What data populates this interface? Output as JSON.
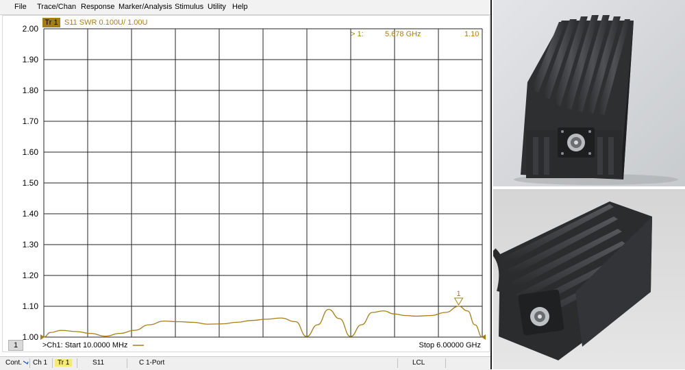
{
  "menu": [
    "File",
    "Trace/Chan",
    "Response",
    "Marker/Analysis",
    "Stimulus",
    "Utility",
    "Help"
  ],
  "trace": {
    "badge": "Tr 1",
    "description": "S11 SWR 0.100U/  1.00U",
    "color": "#a57d18"
  },
  "marker": {
    "label": "> 1:",
    "frequency": "5.678 GHz",
    "value": "1.10",
    "number": "1"
  },
  "channel": {
    "number": "1",
    "start": ">Ch1:  Start  10.0000 MHz",
    "stop": "Stop  6.00000 GHz"
  },
  "status_bar": {
    "mode": "Cont.",
    "channel": "Ch 1",
    "trace": "Tr 1",
    "param": "S11",
    "cal": "C  1-Port",
    "remote": "LCL"
  },
  "chart_data": {
    "type": "line",
    "title": "",
    "xlabel": "",
    "ylabel": "",
    "x_range_ghz": [
      0.01,
      6.0
    ],
    "ylim": [
      1.0,
      2.0
    ],
    "y_ticks": [
      "2.00",
      "1.90",
      "1.80",
      "1.70",
      "1.60",
      "1.50",
      "1.40",
      "1.30",
      "1.20",
      "1.10",
      "1.00"
    ],
    "grid": true,
    "series": [
      {
        "color": "#a57d18",
        "x": [
          0.01,
          0.1,
          0.25,
          0.45,
          0.65,
          0.85,
          1.05,
          1.25,
          1.45,
          1.65,
          1.85,
          2.05,
          2.25,
          2.45,
          2.65,
          2.85,
          3.05,
          3.25,
          3.45,
          3.6,
          3.75,
          3.9,
          4.05,
          4.2,
          4.35,
          4.5,
          4.65,
          4.8,
          4.95,
          5.1,
          5.3,
          5.5,
          5.678,
          5.8,
          5.9,
          6.0
        ],
        "y": [
          1.0,
          1.015,
          1.022,
          1.018,
          1.012,
          1.003,
          1.012,
          1.022,
          1.04,
          1.052,
          1.05,
          1.048,
          1.042,
          1.043,
          1.048,
          1.054,
          1.058,
          1.062,
          1.05,
          1.002,
          1.04,
          1.09,
          1.06,
          1.002,
          1.04,
          1.08,
          1.085,
          1.075,
          1.07,
          1.068,
          1.07,
          1.08,
          1.1,
          1.085,
          1.04,
          1.0
        ]
      }
    ]
  }
}
